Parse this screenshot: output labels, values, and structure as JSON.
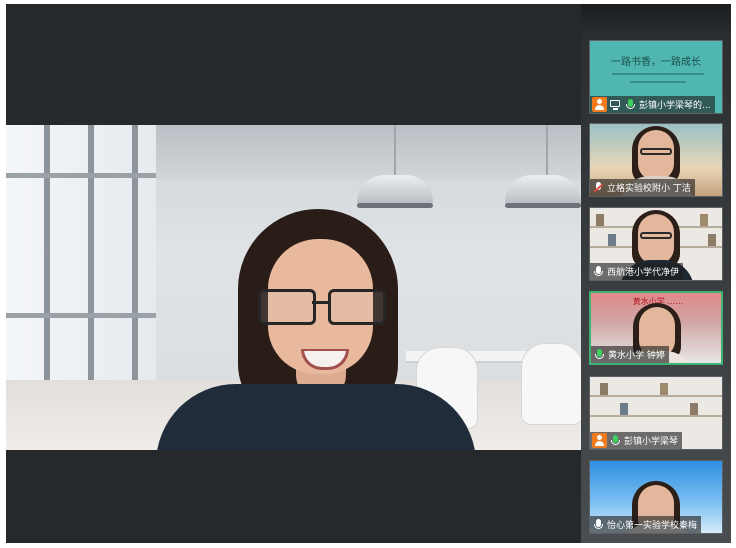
{
  "participants": [
    {
      "name": "彭镇小学梁琴的...",
      "slide": {
        "title": "一路书香，一路成长"
      },
      "icons": [
        "user-avatar-icon",
        "screen-share-icon",
        "mic-active-icon"
      ],
      "accent": "#3ecf5c"
    },
    {
      "name": "立格实验校附小 丁洁",
      "icons": [
        "mic-muted-icon"
      ]
    },
    {
      "name": "西航港小学代净伊",
      "icons": [
        "mic-icon"
      ]
    },
    {
      "name": "黄水小学 钟婷",
      "banner": "黄水小学 ……",
      "icons": [
        "mic-active-icon"
      ],
      "active": true
    },
    {
      "name": "彭镇小学梁琴",
      "icons": [
        "user-avatar-icon",
        "mic-active-icon"
      ]
    },
    {
      "name": "怡心第一实验学校秦梅",
      "icons": [
        "mic-icon"
      ]
    }
  ],
  "colors": {
    "background": "#26292b",
    "active_border": "#3cb371",
    "avatar_badge": "#f07b1f",
    "mic_active": "#3ecf5c"
  }
}
